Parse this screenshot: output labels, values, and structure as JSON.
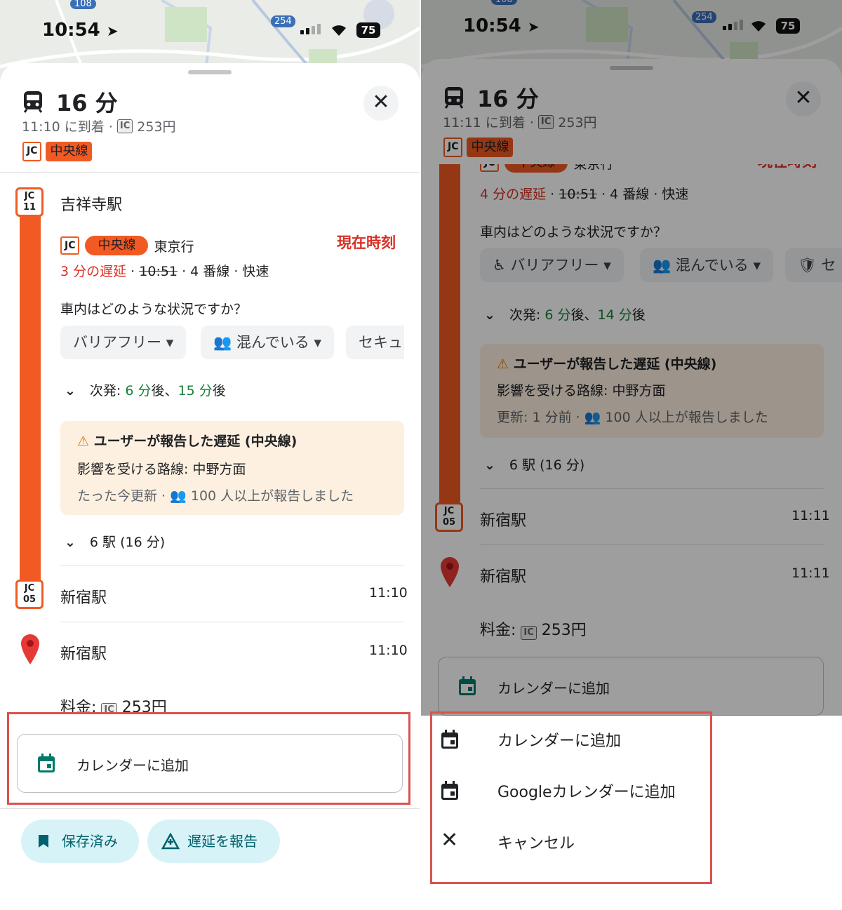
{
  "left": {
    "status": {
      "time": "10:54",
      "battery": "75"
    },
    "map": {
      "road_labels": [
        "108",
        "254"
      ]
    },
    "header": {
      "duration": "16 分",
      "arrival": "11:10 に到着 ·",
      "ic_label": "IC",
      "fare": "253円",
      "line_code": "JC",
      "line_name": "中央線"
    },
    "departure": {
      "station_code_top": "JC",
      "station_code_num": "11",
      "station_name": "吉祥寺駅",
      "line_code": "JC",
      "line_name": "中央線",
      "direction": "東京行",
      "realtime": "現在時刻",
      "delay": "3 分の遅延",
      "sep1": " · ",
      "sched_time": "10:51",
      "details": " · 4 番線 · 快速"
    },
    "question": "車内はどのような状況ですか？",
    "chips": [
      "バリアフリー",
      "混んでいる",
      "セキュ"
    ],
    "next": {
      "prefix": "次発: ",
      "first": "6 分",
      "mid": "後、",
      "second": "15 分",
      "suffix": "後"
    },
    "alert": {
      "title": "ユーザーが報告した遅延 (中央線)",
      "affected": "影響を受ける路線: 中野方面",
      "updated": "たった今更新 ·",
      "reports": "100 人以上が報告しました"
    },
    "stops": "6 駅 (16 分)",
    "arrival_stop": {
      "code_top": "JC",
      "code_num": "05",
      "name": "新宿駅",
      "time": "11:10"
    },
    "destination": {
      "name": "新宿駅",
      "time": "11:10"
    },
    "fare_row": {
      "label": "料金: ",
      "ic": "IC",
      "amount": "253円"
    },
    "calendar_button": "カレンダーに追加",
    "saved_button": "保存済み",
    "report_button": "遅延を報告"
  },
  "right": {
    "status": {
      "time": "10:54",
      "battery": "75"
    },
    "map": {
      "road_labels": [
        "108",
        "254"
      ]
    },
    "header": {
      "duration": "16 分",
      "arrival": "11:11 に到着 ·",
      "ic_label": "IC",
      "fare": "253円",
      "line_code": "JC",
      "line_name": "中央線"
    },
    "partial_row": {
      "line_code": "JC",
      "line_name": "中央線",
      "direction": "東京行",
      "realtime": "現在時刻"
    },
    "delay": "4 分の遅延",
    "sep1": " · ",
    "sched_time": "10:51",
    "details": " · 4 番線 · 快速",
    "question": "車内はどのような状況ですか？",
    "chips": [
      "バリアフリー",
      "混んでいる",
      "セ"
    ],
    "next": {
      "prefix": "次発: ",
      "first": "6 分",
      "mid": "後、",
      "second": "14 分",
      "suffix": "後"
    },
    "alert": {
      "title": "ユーザーが報告した遅延 (中央線)",
      "affected": "影響を受ける路線: 中野方面",
      "updated": "更新: 1 分前 ·",
      "reports": "100 人以上が報告しました"
    },
    "stops": "6 駅 (16 分)",
    "arrival_stop": {
      "code_top": "JC",
      "code_num": "05",
      "name": "新宿駅",
      "time": "11:11"
    },
    "destination": {
      "name": "新宿駅",
      "time": "11:11"
    },
    "fare_row": {
      "label": "料金: ",
      "ic": "IC",
      "amount": "253円"
    },
    "calendar_button": "カレンダーに追加",
    "menu": [
      "カレンダーに追加",
      "Googleカレンダーに追加",
      "キャンセル"
    ]
  },
  "colors": {
    "chuo_line": "#f15a22",
    "highlight": "#d9534f",
    "delay_red": "#d93025",
    "next_green": "#188038"
  }
}
